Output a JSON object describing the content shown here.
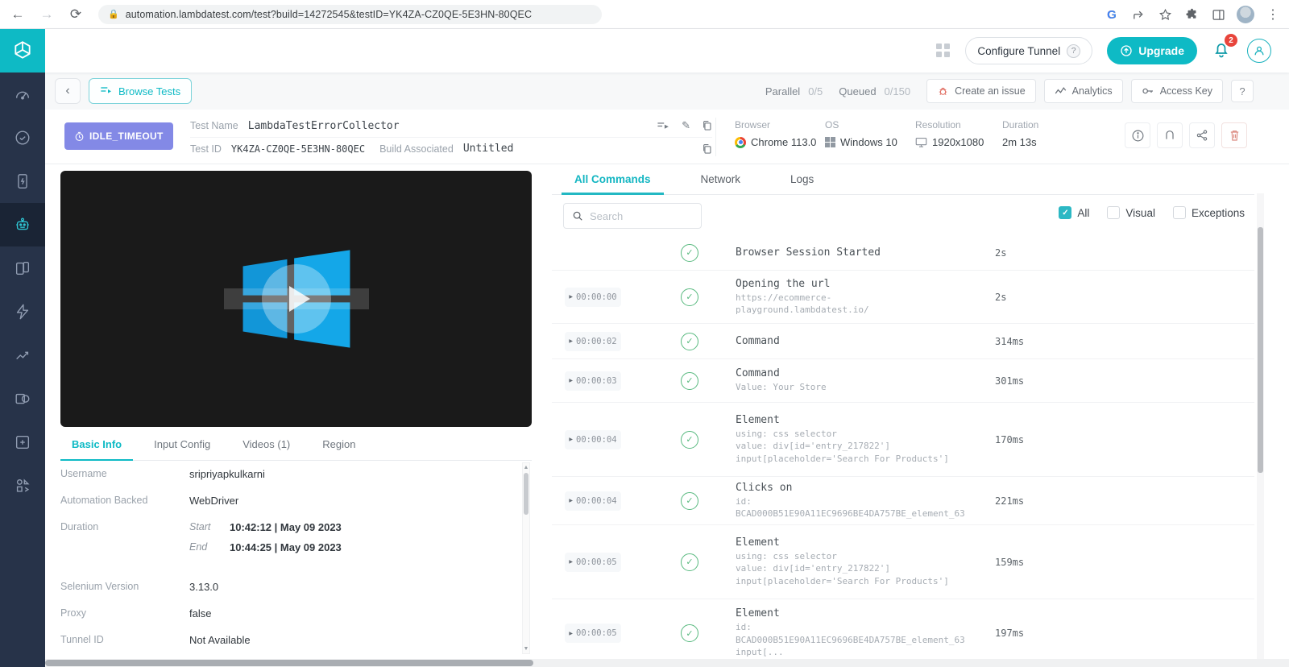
{
  "chrome": {
    "url": "automation.lambdatest.com/test?build=14272545&testID=YK4ZA-CZ0QE-5E3HN-80QEC"
  },
  "header": {
    "configure_tunnel": "Configure Tunnel",
    "tunnel_help": "?",
    "upgrade": "Upgrade",
    "notification_count": "2"
  },
  "toolbar": {
    "browse_tests": "Browse Tests",
    "parallel_label": "Parallel",
    "parallel_value": "0/5",
    "queued_label": "Queued",
    "queued_value": "0/150",
    "create_issue": "Create an issue",
    "analytics": "Analytics",
    "access_key": "Access Key",
    "help": "?"
  },
  "meta": {
    "status": "IDLE_TIMEOUT",
    "test_name_label": "Test Name",
    "test_name": "LambdaTestErrorCollector",
    "test_id_label": "Test ID",
    "test_id": "YK4ZA-CZ0QE-5E3HN-80QEC",
    "build_label": "Build Associated",
    "build": "Untitled",
    "browser_label": "Browser",
    "browser": "Chrome 113.0",
    "os_label": "OS",
    "os": "Windows 10",
    "resolution_label": "Resolution",
    "resolution": "1920x1080",
    "duration_label": "Duration",
    "duration": "2m 13s"
  },
  "left_tabs": [
    {
      "label": "Basic Info"
    },
    {
      "label": "Input Config"
    },
    {
      "label": "Videos (1)"
    },
    {
      "label": "Region"
    }
  ],
  "basic_info": {
    "username_label": "Username",
    "username": "sripriyapkulkarni",
    "backend_label": "Automation Backed",
    "backend": "WebDriver",
    "duration_label": "Duration",
    "start_label": "Start",
    "start": "10:42:12 | May 09 2023",
    "end_label": "End",
    "end": "10:44:25 | May 09 2023",
    "selenium_label": "Selenium Version",
    "selenium": "3.13.0",
    "proxy_label": "Proxy",
    "proxy": "false",
    "tunnel_label": "Tunnel ID",
    "tunnel": "Not Available"
  },
  "right_tabs": [
    {
      "label": "All Commands"
    },
    {
      "label": "Network"
    },
    {
      "label": "Logs"
    }
  ],
  "search": {
    "placeholder": "Search"
  },
  "filters": [
    {
      "label": "All",
      "checked": true
    },
    {
      "label": "Visual",
      "checked": false
    },
    {
      "label": "Exceptions",
      "checked": false
    }
  ],
  "commands": [
    {
      "time": "",
      "title": "Browser Session Started",
      "detail": "",
      "duration": "2s"
    },
    {
      "time": "00:00:00",
      "title": "Opening the url",
      "detail": "https://ecommerce-\nplayground.lambdatest.io/",
      "duration": "2s"
    },
    {
      "time": "00:00:02",
      "title": "Command",
      "detail": "",
      "duration": "314ms"
    },
    {
      "time": "00:00:03",
      "title": "Command",
      "detail": "Value: Your Store",
      "duration": "301ms"
    },
    {
      "time": "00:00:04",
      "title": "Element",
      "detail": "using: css selector\nvalue: div[id='entry_217822'] input[placeholder='Search For Products']",
      "duration": "170ms"
    },
    {
      "time": "00:00:04",
      "title": "Clicks on",
      "detail": "id:\nBCAD000B51E90A11EC9696BE4DA757BE_element_63",
      "duration": "221ms"
    },
    {
      "time": "00:00:05",
      "title": "Element",
      "detail": "using: css selector\nvalue: div[id='entry_217822'] input[placeholder='Search For Products']",
      "duration": "159ms"
    },
    {
      "time": "00:00:05",
      "title": "Element",
      "detail": "id:\nBCAD000B51E90A11EC9696BE4DA757BE_element_63\ninput[...",
      "duration": "197ms"
    }
  ],
  "colors": {
    "accent": "#0ebac5",
    "status_badge": "#8389e6",
    "success": "#57b97e",
    "danger": "#e8453c"
  }
}
